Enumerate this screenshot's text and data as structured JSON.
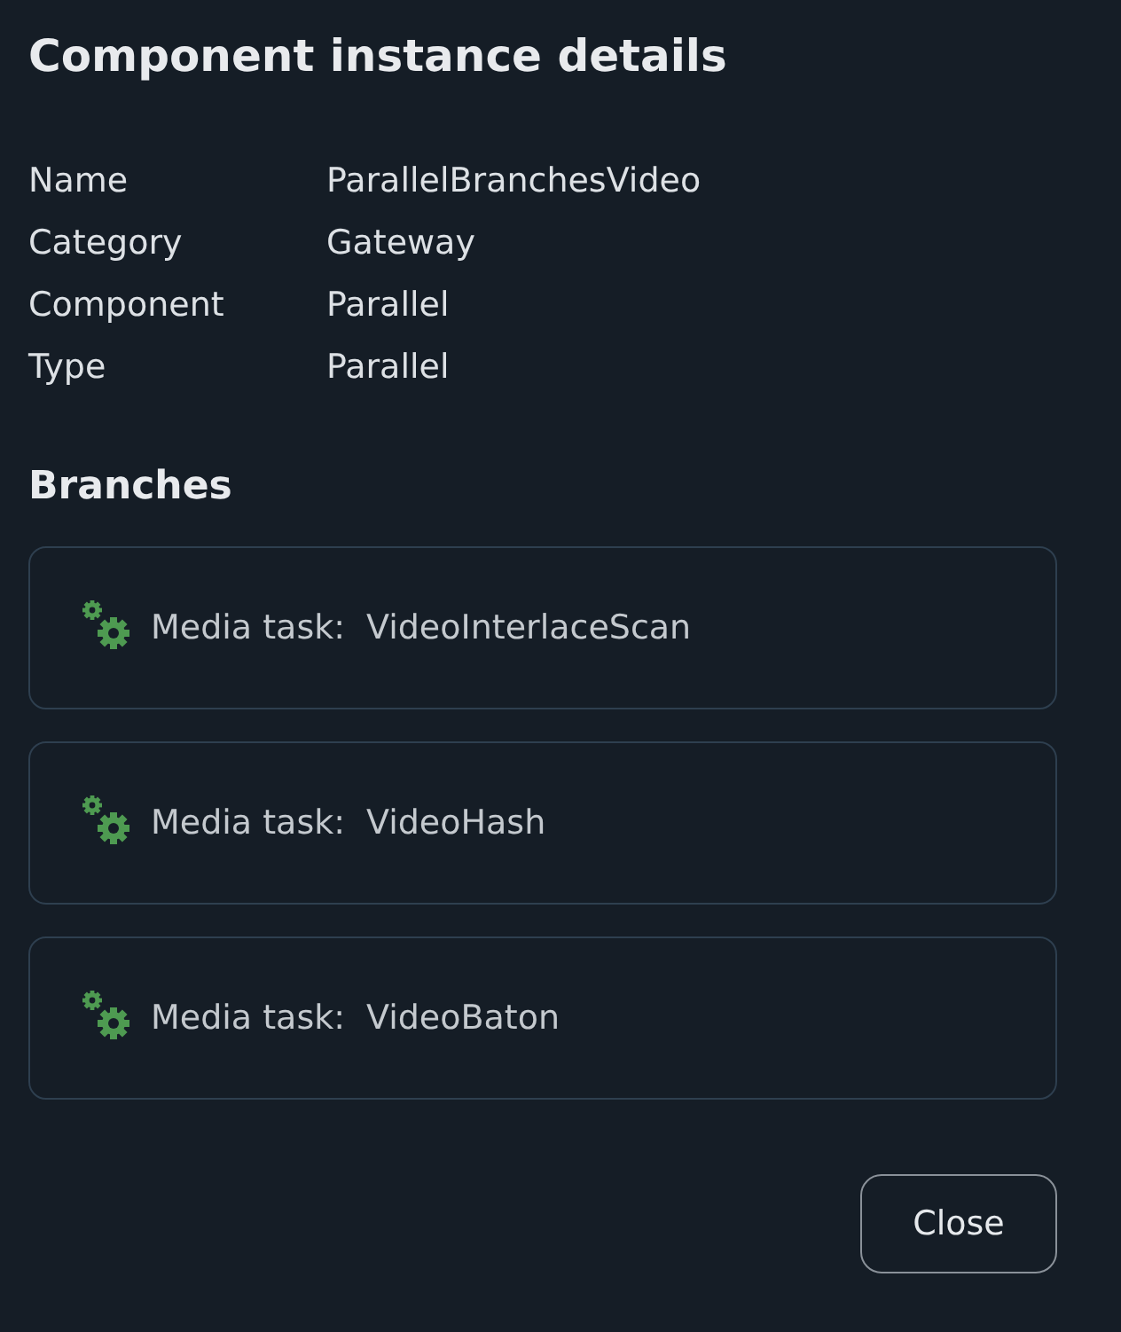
{
  "title": "Component instance details",
  "details": [
    {
      "label": "Name",
      "value": "ParallelBranchesVideo"
    },
    {
      "label": "Category",
      "value": "Gateway"
    },
    {
      "label": "Component",
      "value": "Parallel"
    },
    {
      "label": "Type",
      "value": "Parallel"
    }
  ],
  "branches_heading": "Branches",
  "branches": [
    {
      "label": "Media task:",
      "value": "VideoInterlaceScan"
    },
    {
      "label": "Media task:",
      "value": "VideoHash"
    },
    {
      "label": "Media task:",
      "value": "VideoBaton"
    }
  ],
  "buttons": [
    "Close"
  ]
}
